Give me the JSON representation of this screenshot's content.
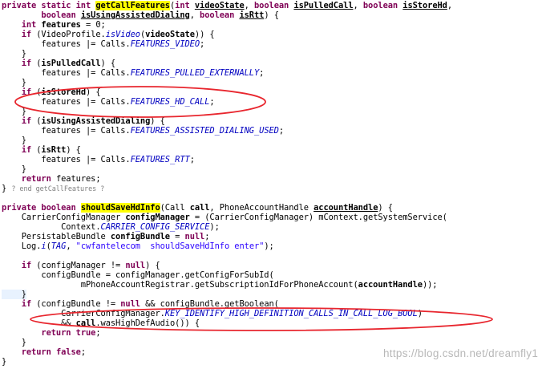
{
  "code_lines": [
    [
      {
        "t": "private static int ",
        "s": "k"
      },
      {
        "t": "getCallFeatures",
        "s": "m"
      },
      {
        "t": "(",
        "s": "t"
      },
      {
        "t": "int ",
        "s": "k"
      },
      {
        "t": "videoState",
        "s": "pu"
      },
      {
        "t": ", ",
        "s": "t"
      },
      {
        "t": "boolean ",
        "s": "k"
      },
      {
        "t": "isPulledCall",
        "s": "pu"
      },
      {
        "t": ", ",
        "s": "t"
      },
      {
        "t": "boolean ",
        "s": "k"
      },
      {
        "t": "isStoreHd",
        "s": "pu"
      },
      {
        "t": ",",
        "s": "t"
      }
    ],
    [
      {
        "t": "        boolean ",
        "s": "k"
      },
      {
        "t": "isUsingAssistedDialing",
        "s": "pu"
      },
      {
        "t": ", ",
        "s": "t"
      },
      {
        "t": "boolean ",
        "s": "k"
      },
      {
        "t": "isRtt",
        "s": "pu"
      },
      {
        "t": ") {",
        "s": "t"
      }
    ],
    [
      {
        "t": "    int ",
        "s": "k"
      },
      {
        "t": "features",
        "s": "p"
      },
      {
        "t": " = 0;",
        "s": "t"
      }
    ],
    [
      {
        "t": "    if ",
        "s": "k"
      },
      {
        "t": "(VideoProfile.",
        "s": "t"
      },
      {
        "t": "isVideo",
        "s": "s"
      },
      {
        "t": "(",
        "s": "t"
      },
      {
        "t": "videoState",
        "s": "p"
      },
      {
        "t": ")) {",
        "s": "t"
      }
    ],
    [
      {
        "t": "        features |= Calls.",
        "s": "t"
      },
      {
        "t": "FEATURES_VIDEO",
        "s": "f"
      },
      {
        "t": ";",
        "s": "t"
      }
    ],
    [
      {
        "t": "    }",
        "s": "t"
      }
    ],
    [
      {
        "t": "    if ",
        "s": "k"
      },
      {
        "t": "(",
        "s": "t"
      },
      {
        "t": "isPulledCall",
        "s": "p"
      },
      {
        "t": ") {",
        "s": "t"
      }
    ],
    [
      {
        "t": "        features |= Calls.",
        "s": "t"
      },
      {
        "t": "FEATURES_PULLED_EXTERNALLY",
        "s": "f"
      },
      {
        "t": ";",
        "s": "t"
      }
    ],
    [
      {
        "t": "    }",
        "s": "t"
      }
    ],
    [
      {
        "t": "    if ",
        "s": "k"
      },
      {
        "t": "(",
        "s": "t"
      },
      {
        "t": "isStoreHd",
        "s": "p"
      },
      {
        "t": ") {",
        "s": "t"
      }
    ],
    [
      {
        "t": "        features |= Calls.",
        "s": "t"
      },
      {
        "t": "FEATURES_HD_CALL",
        "s": "f"
      },
      {
        "t": ";",
        "s": "t"
      }
    ],
    [
      {
        "t": "    }",
        "s": "t"
      }
    ],
    [
      {
        "t": "    if ",
        "s": "k"
      },
      {
        "t": "(",
        "s": "t"
      },
      {
        "t": "isUsingAssistedDialing",
        "s": "p"
      },
      {
        "t": ") {",
        "s": "t"
      }
    ],
    [
      {
        "t": "        features |= Calls.",
        "s": "t"
      },
      {
        "t": "FEATURES_ASSISTED_DIALING_USED",
        "s": "f"
      },
      {
        "t": ";",
        "s": "t"
      }
    ],
    [
      {
        "t": "    }",
        "s": "t"
      }
    ],
    [
      {
        "t": "    if ",
        "s": "k"
      },
      {
        "t": "(",
        "s": "t"
      },
      {
        "t": "isRtt",
        "s": "p"
      },
      {
        "t": ") {",
        "s": "t"
      }
    ],
    [
      {
        "t": "        features |= Calls.",
        "s": "t"
      },
      {
        "t": "FEATURES_RTT",
        "s": "f"
      },
      {
        "t": ";",
        "s": "t"
      }
    ],
    [
      {
        "t": "    }",
        "s": "t"
      }
    ],
    [
      {
        "t": "    return ",
        "s": "k"
      },
      {
        "t": "features;",
        "s": "t"
      }
    ],
    [
      {
        "t": "} ",
        "s": "t"
      },
      {
        "t": "? end getCallFeatures ?",
        "s": "fold"
      }
    ],
    [
      {
        "t": "",
        "s": "t"
      }
    ],
    [
      {
        "t": "private boolean ",
        "s": "k"
      },
      {
        "t": "shouldSaveHdInfo",
        "s": "m"
      },
      {
        "t": "(Call ",
        "s": "t"
      },
      {
        "t": "call",
        "s": "p"
      },
      {
        "t": ", PhoneAccountHandle ",
        "s": "t"
      },
      {
        "t": "accountHandle",
        "s": "pu"
      },
      {
        "t": ") {",
        "s": "t"
      }
    ],
    [
      {
        "t": "    CarrierConfigManager ",
        "s": "t"
      },
      {
        "t": "configManager",
        "s": "p"
      },
      {
        "t": " = (CarrierConfigManager) mContext.getSystemService(",
        "s": "t"
      }
    ],
    [
      {
        "t": "            Context.",
        "s": "t"
      },
      {
        "t": "CARRIER_CONFIG_SERVICE",
        "s": "f"
      },
      {
        "t": ");",
        "s": "t"
      }
    ],
    [
      {
        "t": "    PersistableBundle ",
        "s": "t"
      },
      {
        "t": "configBundle",
        "s": "p"
      },
      {
        "t": " = ",
        "s": "t"
      },
      {
        "t": "null",
        "s": "k"
      },
      {
        "t": ";",
        "s": "t"
      }
    ],
    [
      {
        "t": "    Log.",
        "s": "t"
      },
      {
        "t": "i",
        "s": "s"
      },
      {
        "t": "(",
        "s": "t"
      },
      {
        "t": "TAG",
        "s": "f"
      },
      {
        "t": ", ",
        "s": "t"
      },
      {
        "t": "\"cwfantelecom  shouldSaveHdInfo enter\"",
        "s": "str"
      },
      {
        "t": ");",
        "s": "t"
      }
    ],
    [
      {
        "t": "",
        "s": "t"
      }
    ],
    [
      {
        "t": "    if ",
        "s": "k"
      },
      {
        "t": "(configManager != ",
        "s": "t"
      },
      {
        "t": "null",
        "s": "k"
      },
      {
        "t": ") {",
        "s": "t"
      }
    ],
    [
      {
        "t": "        configBundle = configManager.getConfigForSubId(",
        "s": "t"
      }
    ],
    [
      {
        "t": "                mPhoneAccountRegistrar.getSubscriptionIdForPhoneAccount(",
        "s": "t"
      },
      {
        "t": "accountHandle",
        "s": "p"
      },
      {
        "t": "));",
        "s": "t"
      }
    ],
    [
      {
        "t": "    }",
        "s": "hl"
      }
    ],
    [
      {
        "t": "    if ",
        "s": "k"
      },
      {
        "t": "(configBundle != ",
        "s": "t"
      },
      {
        "t": "null",
        "s": "k"
      },
      {
        "t": " && configBundle.getBoolean(",
        "s": "t"
      }
    ],
    [
      {
        "t": "            CarrierConfigManager.",
        "s": "t"
      },
      {
        "t": "KEY_IDENTIFY_HIGH_DEFINITION_CALLS_IN_CALL_LOG_BOOL",
        "s": "f"
      },
      {
        "t": ")",
        "s": "t"
      }
    ],
    [
      {
        "t": "            && ",
        "s": "t"
      },
      {
        "t": "call",
        "s": "p"
      },
      {
        "t": ".wasHighDefAudio()) {",
        "s": "t"
      }
    ],
    [
      {
        "t": "        return ",
        "s": "k"
      },
      {
        "t": "true",
        "s": "k"
      },
      {
        "t": ";",
        "s": "t"
      }
    ],
    [
      {
        "t": "    }",
        "s": "t"
      }
    ],
    [
      {
        "t": "    return ",
        "s": "k"
      },
      {
        "t": "false",
        "s": "k"
      },
      {
        "t": ";",
        "s": "t"
      }
    ],
    [
      {
        "t": "}",
        "s": "t"
      }
    ]
  ],
  "watermark": "https://blog.csdn.net/dreamfly130",
  "colors": {
    "keyword": "#7f0055",
    "static_field": "#0000c0",
    "string": "#2a00ff",
    "method_highlight": "#ffff00",
    "annotation_ellipse": "#e8262e",
    "watermark": "#b8b8b8"
  }
}
